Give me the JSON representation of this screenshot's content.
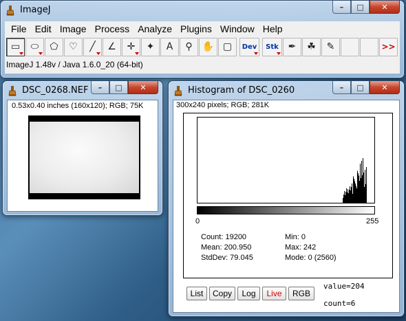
{
  "main_window": {
    "title": "ImageJ",
    "controls": {
      "minimize": "–",
      "maximize": "□",
      "close": "✕"
    },
    "menu": [
      "File",
      "Edit",
      "Image",
      "Process",
      "Analyze",
      "Plugins",
      "Window",
      "Help"
    ],
    "tools": [
      {
        "name": "rectangle-tool-icon",
        "glyph": "▭",
        "selected": true,
        "dropdown": true
      },
      {
        "name": "oval-tool-icon",
        "glyph": "⬭",
        "dropdown": true
      },
      {
        "name": "polygon-tool-icon",
        "glyph": "⬠"
      },
      {
        "name": "freehand-tool-icon",
        "glyph": "♡"
      },
      {
        "name": "line-tool-icon",
        "glyph": "╱",
        "dropdown": true
      },
      {
        "name": "angle-tool-icon",
        "glyph": "∠"
      },
      {
        "name": "point-tool-icon",
        "glyph": "✛",
        "dropdown": true
      },
      {
        "name": "wand-tool-icon",
        "glyph": "✦"
      },
      {
        "name": "text-tool-icon",
        "glyph": "A"
      },
      {
        "name": "magnifier-tool-icon",
        "glyph": "⚲"
      },
      {
        "name": "hand-tool-icon",
        "glyph": "✋"
      },
      {
        "name": "color-picker-tool-icon",
        "glyph": "▢"
      }
    ],
    "dev_label": "Dev",
    "stk_label": "Stk",
    "extra_tools": [
      {
        "name": "brush-tool-icon",
        "glyph": "✒"
      },
      {
        "name": "flood-fill-tool-icon",
        "glyph": "☘"
      },
      {
        "name": "pencil-tool-icon",
        "glyph": "✎"
      }
    ],
    "more_label": ">>",
    "status": "ImageJ 1.48v / Java 1.6.0_20 (64-bit)"
  },
  "image_window": {
    "title": "DSC_0268.NEF",
    "info": "0.53x0.40 inches (160x120); RGB; 75K"
  },
  "histogram_window": {
    "title": "Histogram of DSC_0260",
    "info": "300x240 pixels; RGB; 281K",
    "axis_min": "0",
    "axis_max": "255",
    "stats": {
      "count": "Count: 19200",
      "mean": "Mean: 200.950",
      "stddev": "StdDev: 79.045",
      "min": "Min: 0",
      "max": "Max: 242",
      "mode": "Mode: 0 (2560)"
    },
    "buttons": {
      "list": "List",
      "copy": "Copy",
      "log": "Log",
      "live": "Live",
      "rgb": "RGB"
    },
    "value_readout": "value=204",
    "count_readout": "count=6",
    "colors": {
      "live": "#cc0000"
    }
  }
}
